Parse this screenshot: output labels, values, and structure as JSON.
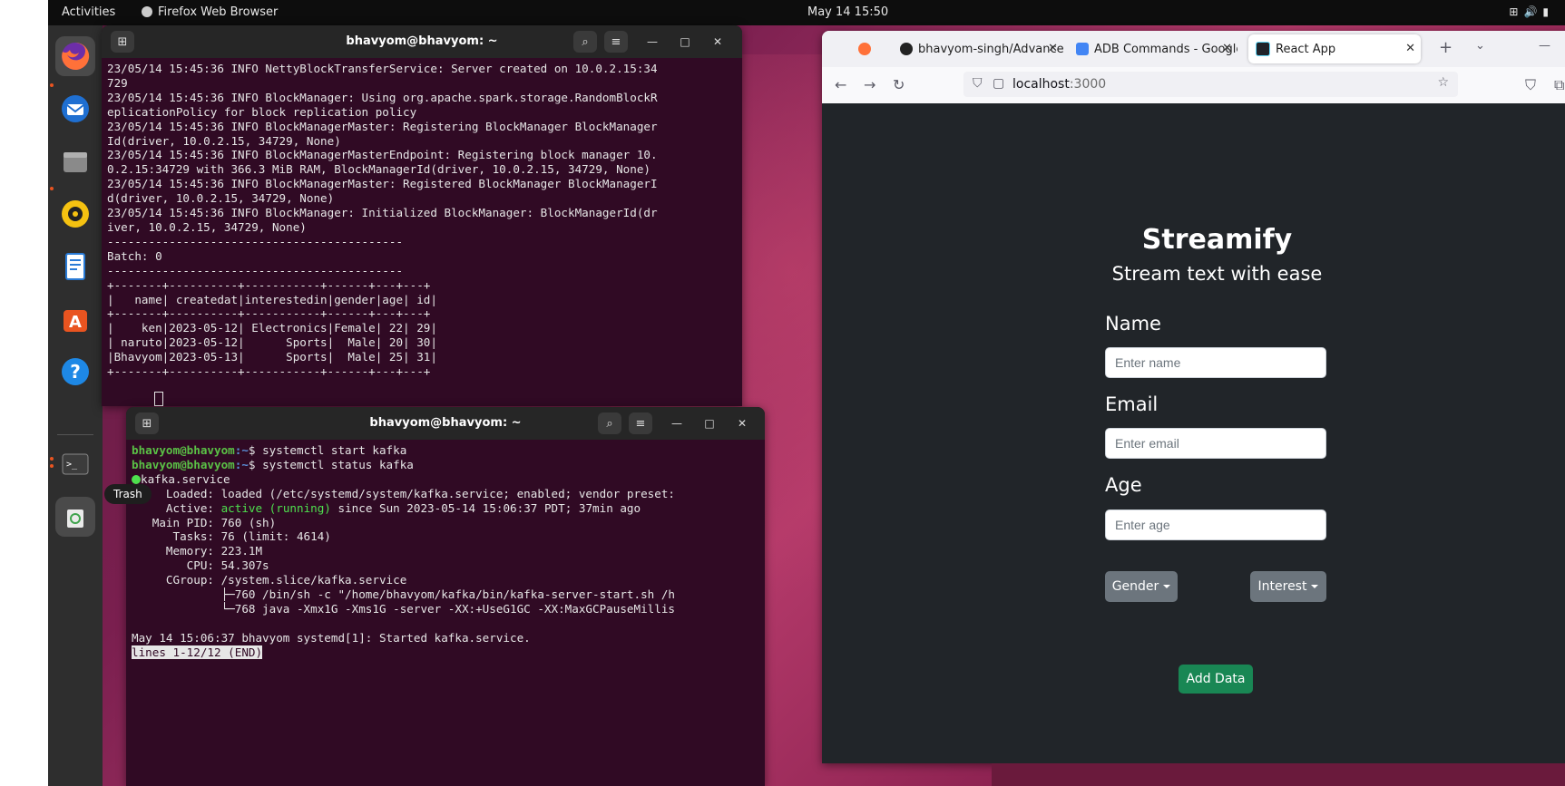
{
  "topbar": {
    "activities": "Activities",
    "app_name": "Firefox Web Browser",
    "clock": "May 14  15:50"
  },
  "dock": {
    "trash_tooltip": "Trash",
    "icons": [
      "firefox-icon",
      "thunderbird-icon",
      "files-icon",
      "rhythmbox-icon",
      "writer-icon",
      "software-icon",
      "help-icon",
      "terminal-icon",
      "trash-icon",
      "show-apps-icon"
    ]
  },
  "terminal1": {
    "title": "bhavyom@bhavyom: ~",
    "lines": [
      "23/05/14 15:45:36 INFO NettyBlockTransferService: Server created on 10.0.2.15:34",
      "729",
      "23/05/14 15:45:36 INFO BlockManager: Using org.apache.spark.storage.RandomBlockR",
      "eplicationPolicy for block replication policy",
      "23/05/14 15:45:36 INFO BlockManagerMaster: Registering BlockManager BlockManager",
      "Id(driver, 10.0.2.15, 34729, None)",
      "23/05/14 15:45:36 INFO BlockManagerMasterEndpoint: Registering block manager 10.",
      "0.2.15:34729 with 366.3 MiB RAM, BlockManagerId(driver, 10.0.2.15, 34729, None)",
      "23/05/14 15:45:36 INFO BlockManagerMaster: Registered BlockManager BlockManagerI",
      "d(driver, 10.0.2.15, 34729, None)",
      "23/05/14 15:45:36 INFO BlockManager: Initialized BlockManager: BlockManagerId(dr",
      "iver, 10.0.2.15, 34729, None)",
      "-------------------------------------------",
      "Batch: 0",
      "-------------------------------------------",
      "+-------+----------+-----------+------+---+---+",
      "|   name| createdat|interestedin|gender|age| id|",
      "+-------+----------+-----------+------+---+---+",
      "|    ken|2023-05-12| Electronics|Female| 22| 29|",
      "| naruto|2023-05-12|      Sports|  Male| 20| 30|",
      "|Bhavyom|2023-05-13|      Sports|  Male| 25| 31|",
      "+-------+----------+-----------+------+---+---+"
    ]
  },
  "terminal2": {
    "title": "bhavyom@bhavyom: ~",
    "prompt_user": "bhavyom@bhavyom",
    "prompt_path": ":~",
    "cmd1": "$ systemctl start kafka",
    "cmd2": "$ systemctl status kafka",
    "service_name": "kafka.service",
    "loaded": "     Loaded: loaded (/etc/systemd/system/kafka.service; enabled; vendor preset:",
    "active_label": "     Active: ",
    "active_state": "active (running)",
    "active_rest": " since Sun 2023-05-14 15:06:37 PDT; 37min ago",
    "more_lines": [
      "   Main PID: 760 (sh)",
      "      Tasks: 76 (limit: 4614)",
      "     Memory: 223.1M",
      "        CPU: 54.307s",
      "     CGroup: /system.slice/kafka.service",
      "             ├─760 /bin/sh -c \"/home/bhavyom/kafka/bin/kafka-server-start.sh /h",
      "             └─768 java -Xmx1G -Xms1G -server -XX:+UseG1GC -XX:MaxGCPauseMillis",
      "",
      "May 14 15:06:37 bhavyom systemd[1]: Started kafka.service."
    ],
    "pager": "lines 1-12/12 (END)"
  },
  "firefox": {
    "tabs": [
      {
        "label": "bhavyom-singh/Advancet",
        "icon": "github-icon"
      },
      {
        "label": "ADB Commands - Google",
        "icon": "docs-icon"
      },
      {
        "label": "React App",
        "icon": "react-icon"
      }
    ],
    "url_host": "localhost",
    "url_port": ":3000"
  },
  "app": {
    "title": "Streamify",
    "subtitle": "Stream text with ease",
    "name_label": "Name",
    "name_placeholder": "Enter name",
    "email_label": "Email",
    "email_placeholder": "Enter email",
    "age_label": "Age",
    "age_placeholder": "Enter age",
    "gender_button": "Gender",
    "interest_button": "Interest",
    "add_button": "Add Data"
  },
  "colors": {
    "terminal_bg": "#300a24",
    "app_bg": "#212529",
    "add_button": "#198754",
    "dropdown_button": "#6c757d"
  }
}
